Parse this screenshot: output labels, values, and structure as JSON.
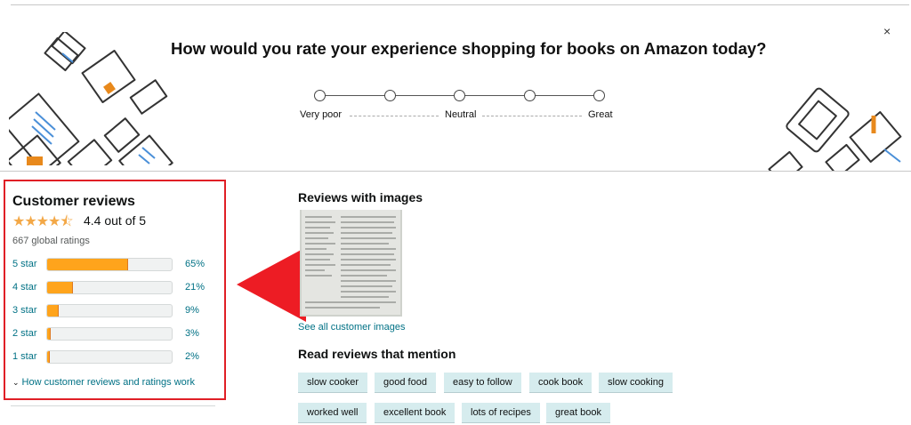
{
  "survey": {
    "title": "How would you rate your experience shopping for books on Amazon today?",
    "close": "×",
    "scale_labels": [
      "Very poor",
      "Neutral",
      "Great"
    ]
  },
  "reviews": {
    "title": "Customer reviews",
    "stars_icon": "★★★★⯪",
    "rating": 4.4,
    "rating_text": "4.4 out of 5",
    "global_ratings": "667 global ratings",
    "histogram": [
      {
        "label": "5 star",
        "pct_text": "65%",
        "pct": 65
      },
      {
        "label": "4 star",
        "pct_text": "21%",
        "pct": 21
      },
      {
        "label": "3 star",
        "pct_text": "9%",
        "pct": 9
      },
      {
        "label": "2 star",
        "pct_text": "3%",
        "pct": 3
      },
      {
        "label": "1 star",
        "pct_text": "2%",
        "pct": 2
      }
    ],
    "how_link": "How customer reviews and ratings work"
  },
  "images": {
    "title": "Reviews with images",
    "see_all": "See all customer images"
  },
  "mentions": {
    "title": "Read reviews that mention",
    "chips": [
      "slow cooker",
      "good food",
      "easy to follow",
      "cook book",
      "slow cooking",
      "worked well",
      "excellent book",
      "lots of recipes",
      "great book"
    ]
  },
  "colors": {
    "highlight_border": "#e01f26",
    "arrow": "#ed1c24",
    "star": "#f3a847",
    "bar_fill": "#ffa41c",
    "link": "#007185",
    "chip_bg": "#d6ecee"
  }
}
